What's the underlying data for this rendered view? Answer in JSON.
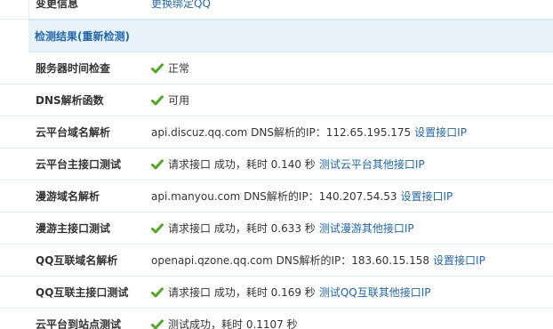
{
  "top_row": {
    "label": "变更信息",
    "link": "更换绑定QQ"
  },
  "section": {
    "title_prefix": "检测结果(",
    "recheck_link": "重新检测",
    "title_suffix": ")"
  },
  "rows": [
    {
      "label": "服务器时间检查",
      "check": true,
      "text": "正常",
      "link": ""
    },
    {
      "label": "DNS解析函数",
      "check": true,
      "text": "可用",
      "link": ""
    },
    {
      "label": "云平台域名解析",
      "check": false,
      "text": "api.discuz.qq.com DNS解析的IP：112.65.195.175",
      "link": "设置接口IP"
    },
    {
      "label": "云平台主接口测试",
      "check": true,
      "text": "请求接口 成功，耗时 0.140 秒",
      "link": "测试云平台其他接口IP"
    },
    {
      "label": "漫游域名解析",
      "check": false,
      "text": "api.manyou.com DNS解析的IP：140.207.54.53",
      "link": "设置接口IP"
    },
    {
      "label": "漫游主接口测试",
      "check": true,
      "text": "请求接口 成功，耗时 0.633 秒",
      "link": "测试漫游其他接口IP"
    },
    {
      "label": "QQ互联域名解析",
      "check": false,
      "text": "openapi.qzone.qq.com DNS解析的IP：183.60.15.158",
      "link": "设置接口IP"
    },
    {
      "label": "QQ互联主接口测试",
      "check": true,
      "text": "请求接口 成功，耗时 0.169 秒",
      "link": "测试QQ互联其他接口IP"
    },
    {
      "label": "云平台到站点测试",
      "check": true,
      "text": "测试成功，耗时 0.1107 秒",
      "link": ""
    }
  ],
  "colors": {
    "link": "#2366a8",
    "check": "#4fa82a",
    "header_bg": "#e8f2fb"
  },
  "icons": {
    "check": "check-icon"
  }
}
